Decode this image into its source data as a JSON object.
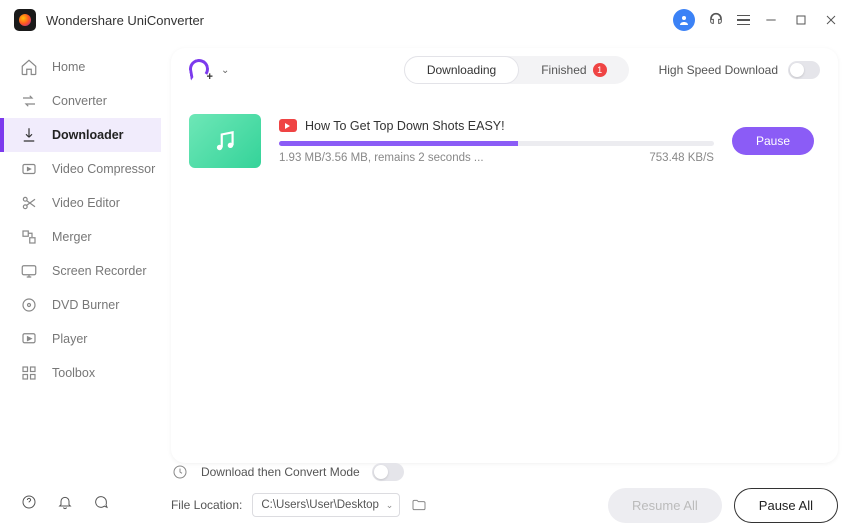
{
  "app": {
    "title": "Wondershare UniConverter"
  },
  "sidebar": {
    "items": [
      {
        "label": "Home",
        "icon": "home"
      },
      {
        "label": "Converter",
        "icon": "converter"
      },
      {
        "label": "Downloader",
        "icon": "downloader",
        "active": true
      },
      {
        "label": "Video Compressor",
        "icon": "compressor"
      },
      {
        "label": "Video Editor",
        "icon": "editor"
      },
      {
        "label": "Merger",
        "icon": "merger"
      },
      {
        "label": "Screen Recorder",
        "icon": "recorder"
      },
      {
        "label": "DVD Burner",
        "icon": "dvd"
      },
      {
        "label": "Player",
        "icon": "player"
      },
      {
        "label": "Toolbox",
        "icon": "toolbox"
      }
    ]
  },
  "tabs": {
    "downloading": {
      "label": "Downloading"
    },
    "finished": {
      "label": "Finished",
      "badge": "1"
    }
  },
  "high_speed": {
    "label": "High Speed Download",
    "on": false
  },
  "download": {
    "title": "How To Get Top Down Shots EASY!",
    "status_text": "1.93 MB/3.56 MB, remains 2 seconds ...",
    "speed": "753.48 KB/S",
    "progress_pct": 55,
    "pause_label": "Pause"
  },
  "bottom": {
    "convert_mode_label": "Download then Convert Mode",
    "file_location_label": "File Location:",
    "file_location_path": "C:\\Users\\User\\Desktop",
    "resume_all": "Resume All",
    "pause_all": "Pause All"
  }
}
